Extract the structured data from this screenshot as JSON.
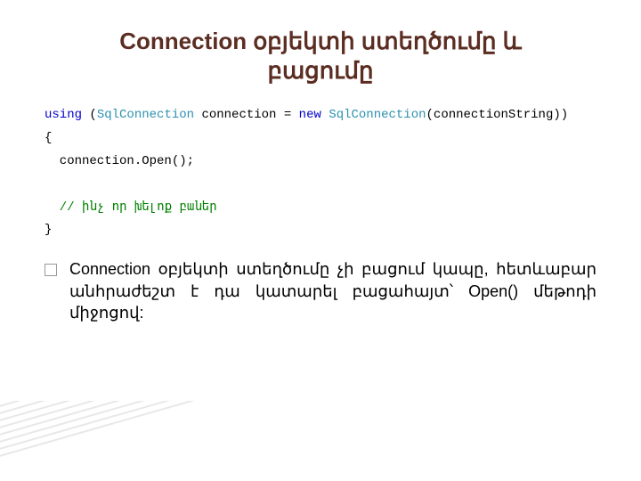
{
  "title_line1": "Connection օբյեկտի ստեղծումը և",
  "title_line2": "բացումը",
  "code": {
    "l1_using": "using",
    "l1_paren": " (",
    "l1_type1": "SqlConnection",
    "l1_mid": " connection = ",
    "l1_new": "new",
    "l1_sp": " ",
    "l1_type2": "SqlConnection",
    "l1_end": "(connectionString))",
    "l2": "{",
    "l3": "  connection.Open();",
    "l4": "",
    "l5_comment": "  // ինչ որ խելոք բաներ",
    "l6": "}"
  },
  "bullet": "Connection օբյեկտի ստեղծումը չի բացում կապը, հետևաբար անհրաժեշտ է դա կատարել բացահայտ՝ Open() մեթոդի միջոցով:"
}
